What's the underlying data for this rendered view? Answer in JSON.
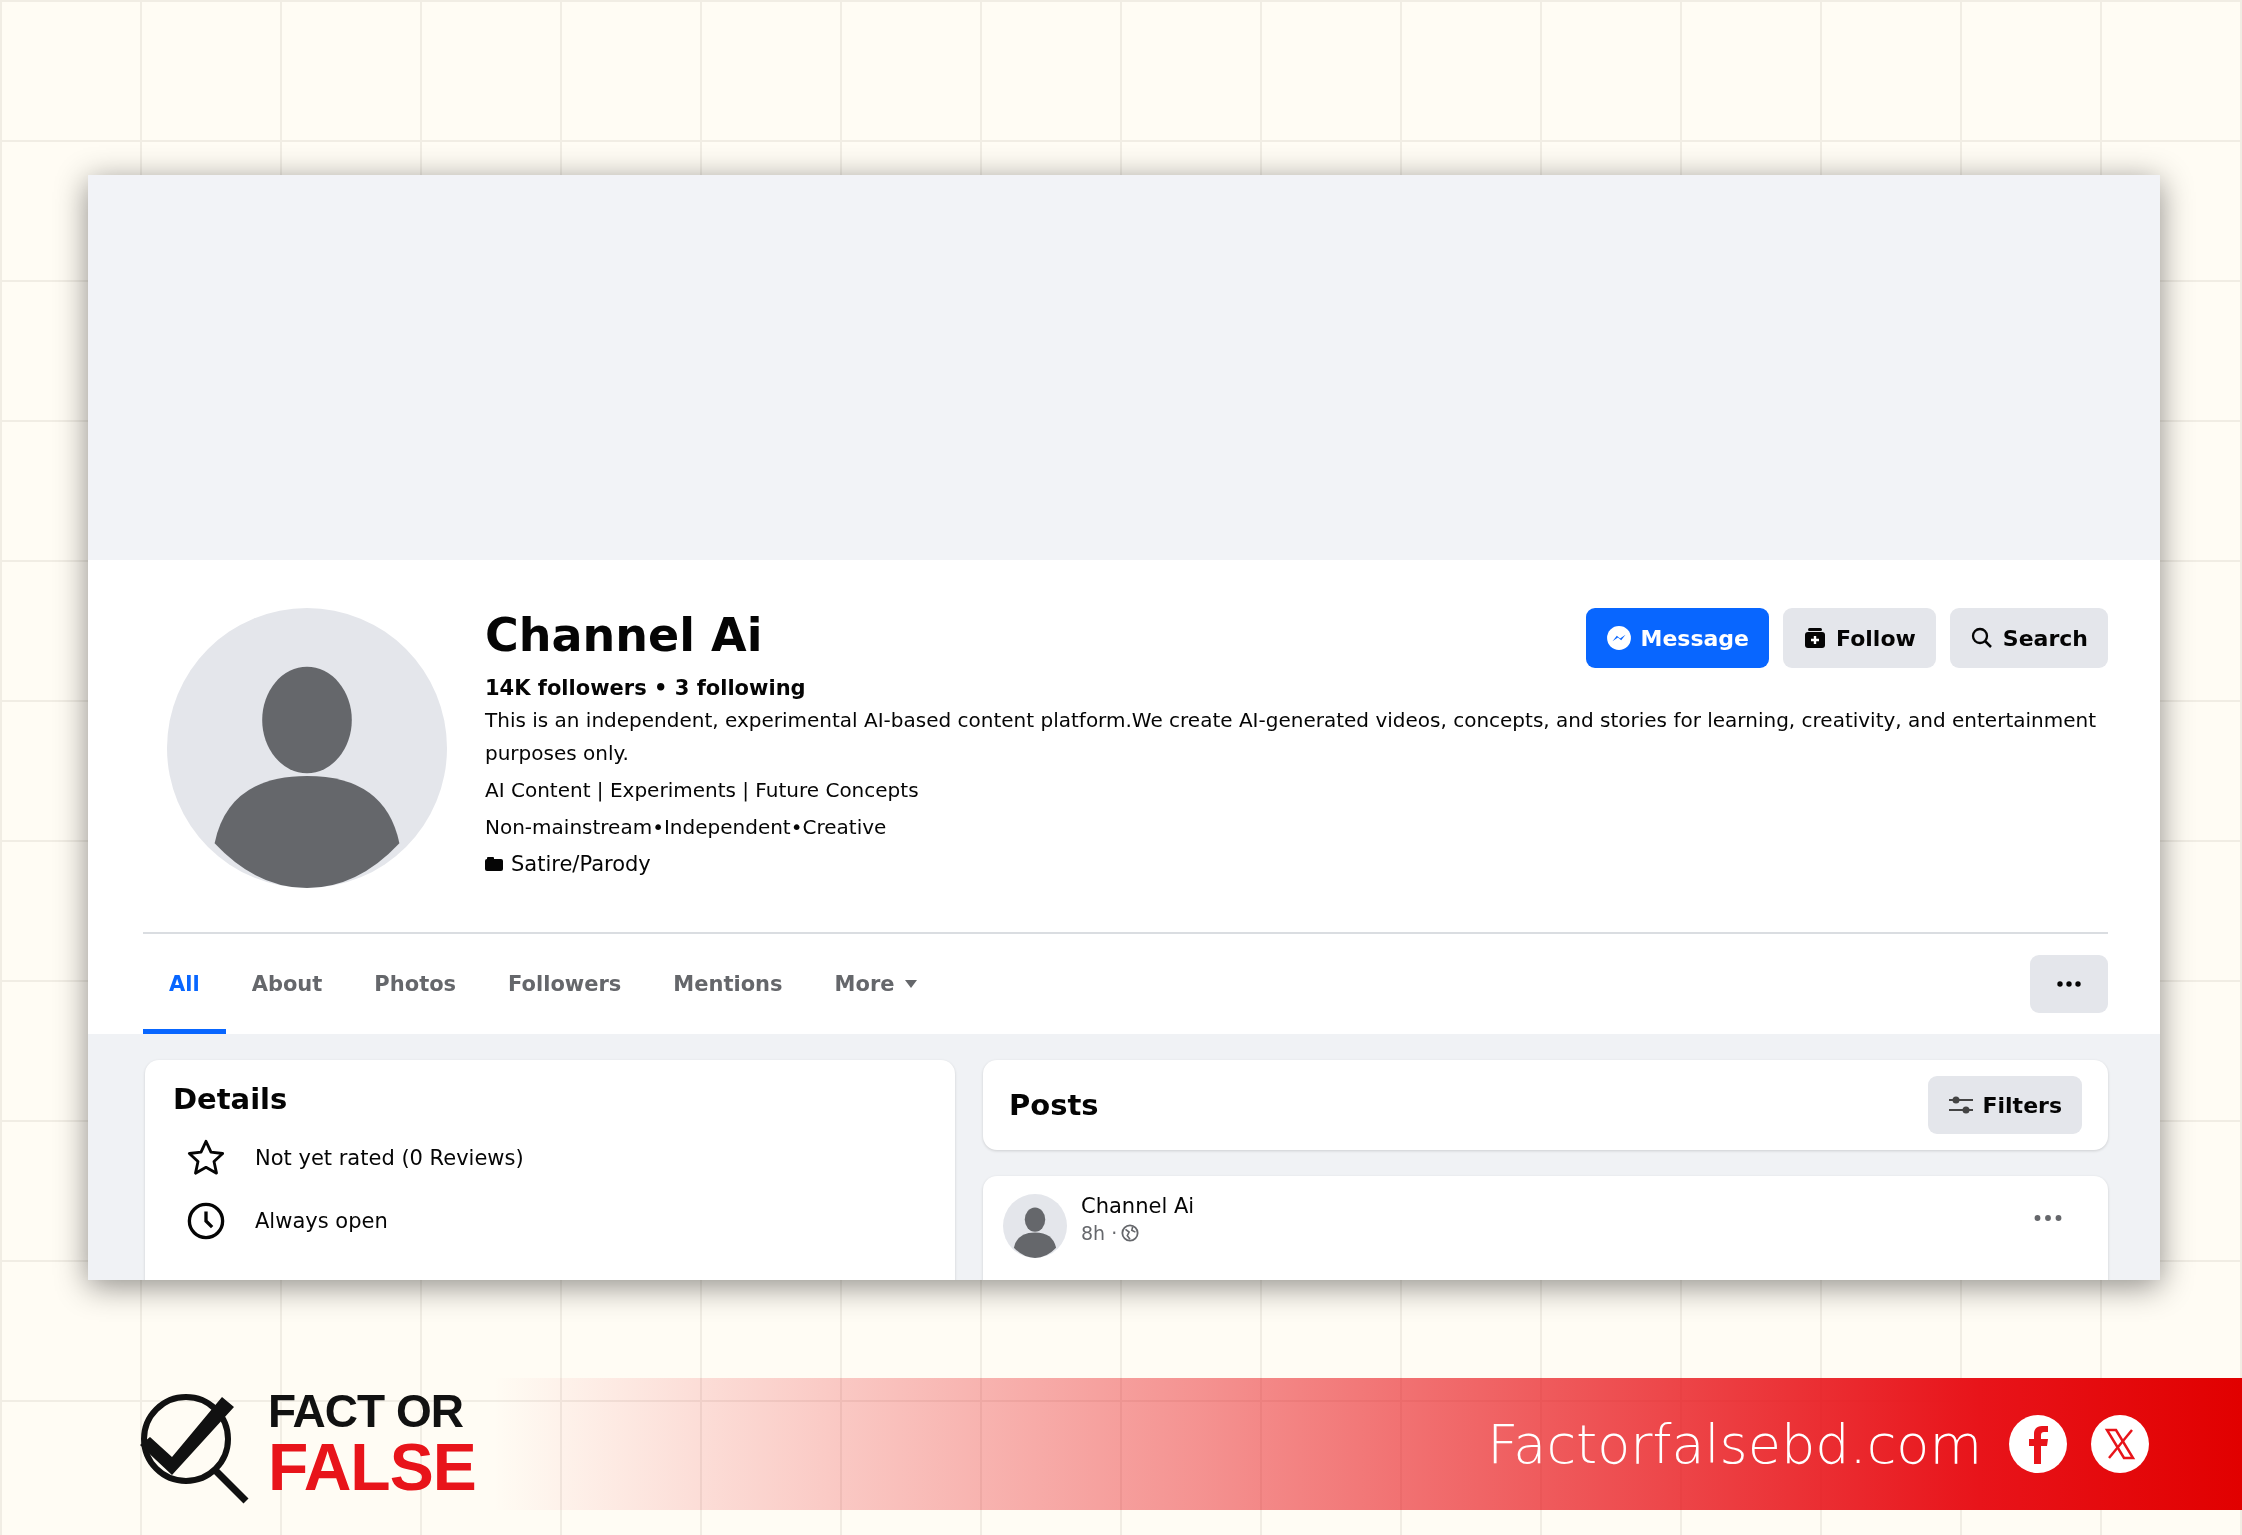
{
  "profile": {
    "name": "Channel Ai",
    "stats": "14K followers • 3 following",
    "bio": [
      "This is an independent, experimental AI-based content platform.We create AI-generated videos, concepts, and stories for learning, creativity, and entertainment purposes only.",
      "AI Content | Experiments | Future Concepts",
      "Non-mainstream•Independent•Creative"
    ],
    "category": "Satire/Parody"
  },
  "actions": [
    {
      "label": "Message",
      "kind": "message"
    },
    {
      "label": "Follow",
      "kind": "follow"
    },
    {
      "label": "Search",
      "kind": "search"
    }
  ],
  "tabs": [
    {
      "label": "All",
      "selected": true,
      "kind": "link"
    },
    {
      "label": "About",
      "selected": false,
      "kind": "link"
    },
    {
      "label": "Photos",
      "selected": false,
      "kind": "link"
    },
    {
      "label": "Followers",
      "selected": false,
      "kind": "link"
    },
    {
      "label": "Mentions",
      "selected": false,
      "kind": "link"
    },
    {
      "label": "More",
      "selected": false,
      "kind": "dropdown"
    }
  ],
  "details": {
    "title": "Details",
    "items": [
      {
        "kind": "rating",
        "text": "Not yet rated (0 Reviews)"
      },
      {
        "kind": "hours",
        "text": "Always open"
      }
    ]
  },
  "posts": {
    "title": "Posts",
    "filters": "Filters",
    "post": {
      "author": "Channel Ai",
      "time": "8h ·"
    }
  },
  "brand": {
    "logo_top": "FACT OR",
    "logo_bottom": "FALSE",
    "site": "Factorfalsebd.com"
  }
}
